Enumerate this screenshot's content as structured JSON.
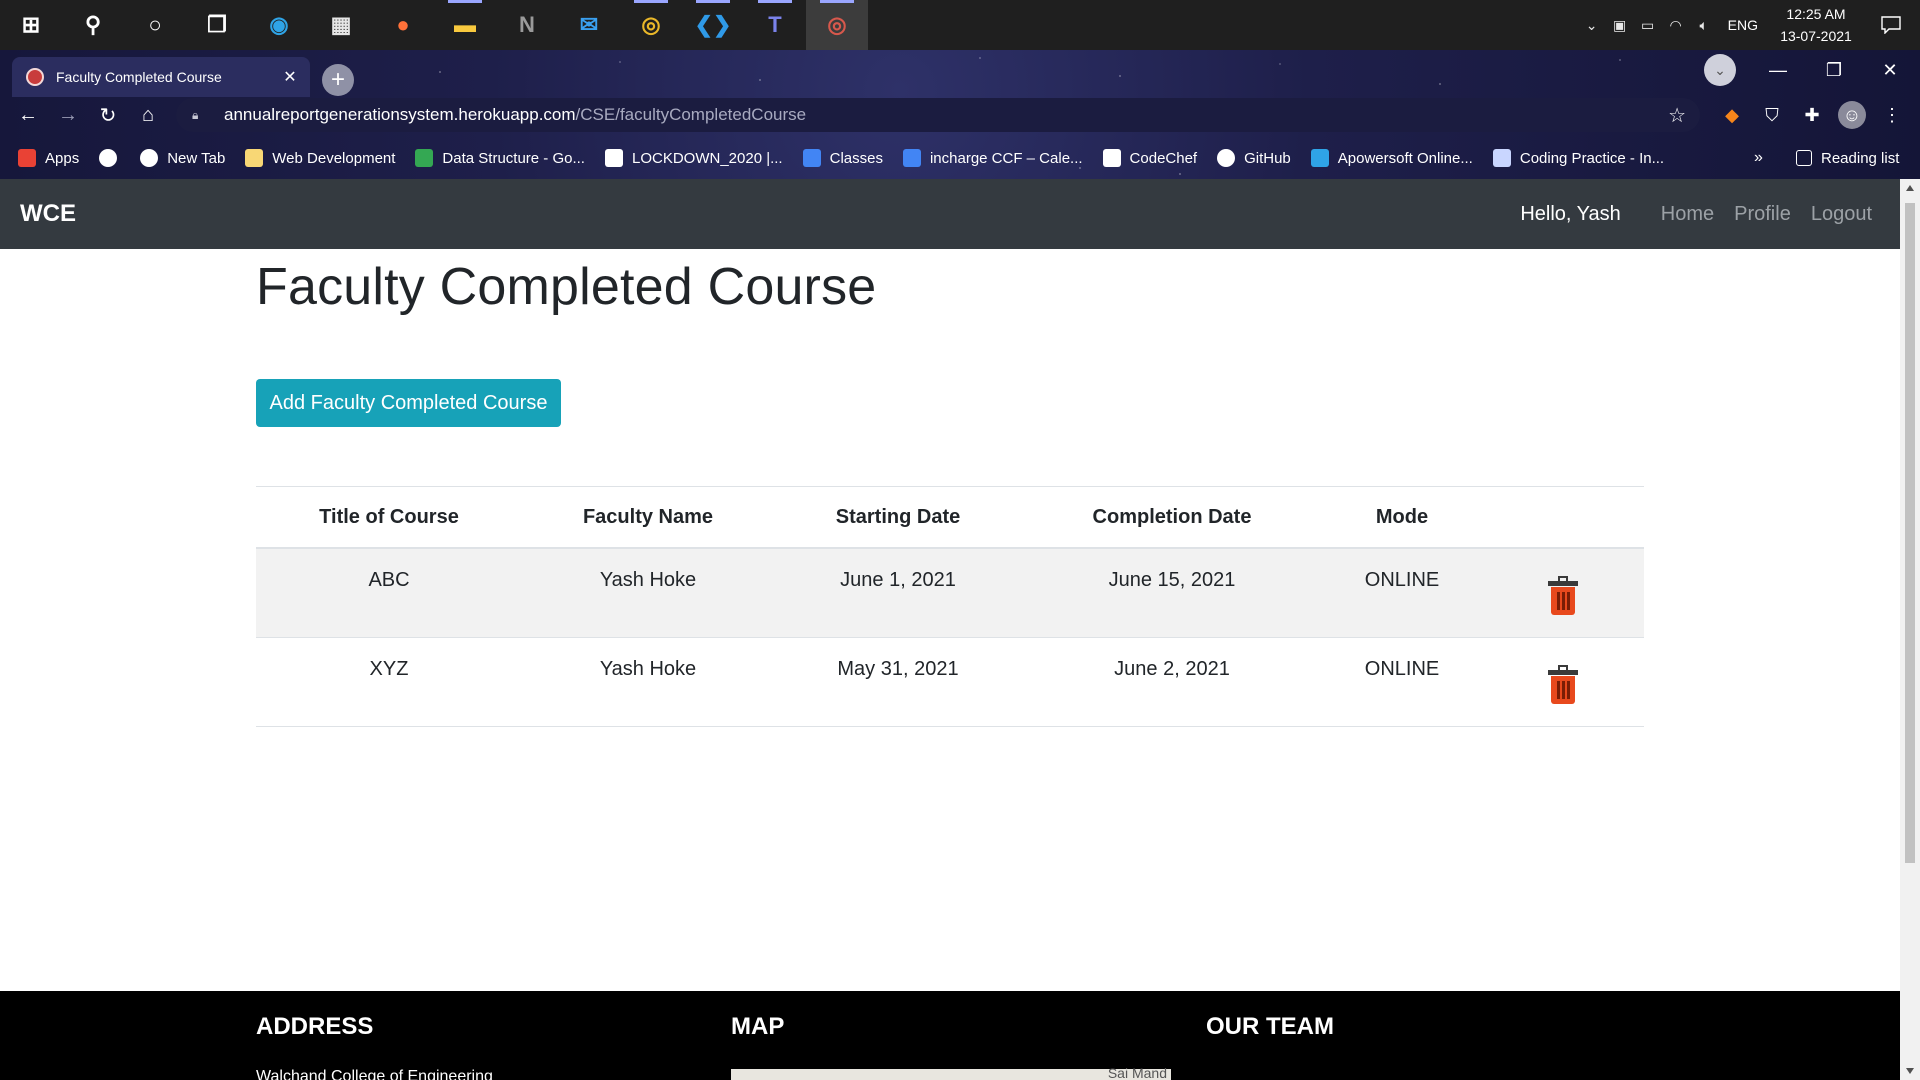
{
  "taskbar": {
    "apps": [
      {
        "name": "start-icon",
        "glyph": "⊞",
        "color": "#ffffff"
      },
      {
        "name": "search-icon",
        "glyph": "⚲",
        "color": "#ffffff"
      },
      {
        "name": "cortana-icon",
        "glyph": "○",
        "color": "#ffffff"
      },
      {
        "name": "task-view-icon",
        "glyph": "❐",
        "color": "#ffffff"
      },
      {
        "name": "edge-icon",
        "glyph": "◉",
        "color": "#2fa4e7"
      },
      {
        "name": "store-icon",
        "glyph": "▦",
        "color": "#e6e6e6"
      },
      {
        "name": "firefox-icon",
        "glyph": "●",
        "color": "#ff7139"
      },
      {
        "name": "file-explorer-icon",
        "glyph": "▬",
        "color": "#f8c93e"
      },
      {
        "name": "notion-icon",
        "glyph": "N",
        "color": "#9a9a9a"
      },
      {
        "name": "mail-icon",
        "glyph": "✉",
        "color": "#3aa0f0"
      },
      {
        "name": "chrome-icon",
        "glyph": "◎",
        "color": "#e9b729"
      },
      {
        "name": "vscode-icon",
        "glyph": "❮❯",
        "color": "#2f9ae8"
      },
      {
        "name": "teams-icon",
        "glyph": "T",
        "color": "#7b83eb"
      },
      {
        "name": "chrome-profile-icon",
        "glyph": "◎",
        "color": "#d7584c"
      }
    ],
    "lang": "ENG",
    "time": "12:25 AM",
    "date": "13-07-2021"
  },
  "browser": {
    "tab_title": "Faculty Completed Course",
    "url_host": "annualreportgenerationsystem.herokuapp.com",
    "url_path": "/CSE/facultyCompletedCourse",
    "bookmarks": [
      {
        "label": "Apps",
        "icon": "apps-grid-icon",
        "color": "#e94235"
      },
      {
        "label": "",
        "icon": "globe-icon",
        "color": "#ffffff"
      },
      {
        "label": "New Tab",
        "icon": "globe-icon",
        "color": "#ffffff"
      },
      {
        "label": "Web Development",
        "icon": "folder-icon",
        "color": "#f8d775"
      },
      {
        "label": "Data Structure - Go...",
        "icon": "drive-icon",
        "color": "#34a853"
      },
      {
        "label": "LOCKDOWN_2020 |...",
        "icon": "doc-icon",
        "color": "#ffffff"
      },
      {
        "label": "Classes",
        "icon": "classroom-icon",
        "color": "#4285f4"
      },
      {
        "label": "incharge CCF – Cale...",
        "icon": "calendar-icon",
        "color": "#4285f4"
      },
      {
        "label": "CodeChef",
        "icon": "codechef-icon",
        "color": "#ffffff"
      },
      {
        "label": "GitHub",
        "icon": "github-icon",
        "color": "#ffffff"
      },
      {
        "label": "Apowersoft Online...",
        "icon": "apowersoft-icon",
        "color": "#2fa4e7"
      },
      {
        "label": "Coding Practice - In...",
        "icon": "mountain-icon",
        "color": "#c9d6ff"
      }
    ],
    "more": "»",
    "reading_list": "Reading list"
  },
  "navbar": {
    "brand": "WCE",
    "greeting": "Hello, Yash",
    "links": [
      "Home",
      "Profile",
      "Logout"
    ]
  },
  "main": {
    "title": "Faculty Completed Course",
    "add_button": "Add Faculty Completed Course",
    "table": {
      "headers": [
        "Title of Course",
        "Faculty Name",
        "Starting Date",
        "Completion Date",
        "Mode",
        ""
      ],
      "rows": [
        [
          "ABC",
          "Yash Hoke",
          "June 1, 2021",
          "June 15, 2021",
          "ONLINE"
        ],
        [
          "XYZ",
          "Yash Hoke",
          "May 31, 2021",
          "June 2, 2021",
          "ONLINE"
        ]
      ]
    }
  },
  "footer": {
    "address_heading": "ADDRESS",
    "map_heading": "MAP",
    "team_heading": "OUR TEAM",
    "address_line": "Walchand College of Engineering",
    "map_label": "Sai Mand"
  },
  "colors": {
    "accent": "#17a2b8",
    "navbar": "#343a40",
    "delete_icon": "#e8491d"
  }
}
